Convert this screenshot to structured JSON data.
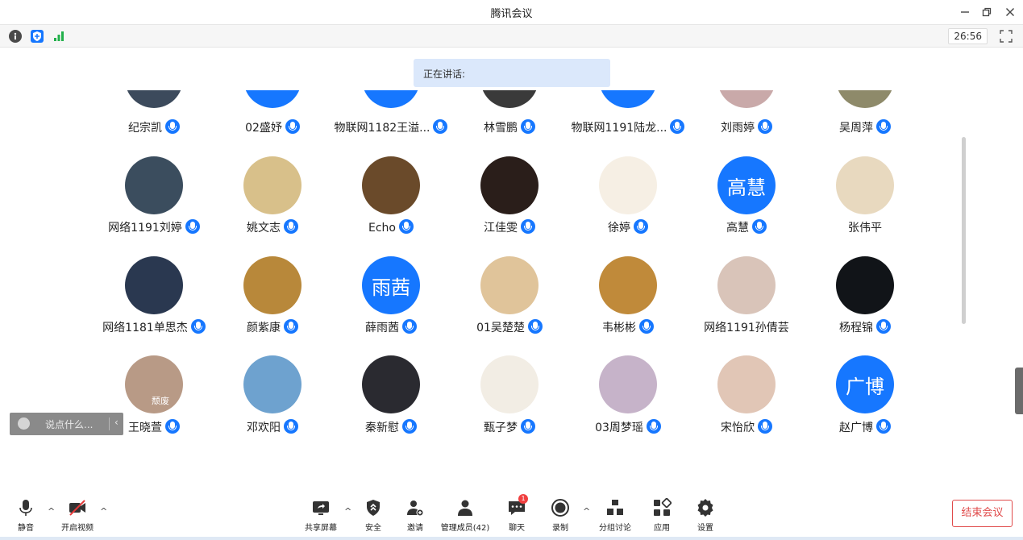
{
  "window": {
    "title": "腾讯会议",
    "timer": "26:56"
  },
  "speaking": "正在讲话:",
  "participants": [
    {
      "name": "纪宗凯",
      "avatar_color": "#3c4a5c",
      "avatar_text": ""
    },
    {
      "name": "02盛妤",
      "avatar_color": "#1677ff",
      "avatar_text": ""
    },
    {
      "name": "物联网1182王溢...",
      "avatar_color": "#1677ff",
      "avatar_text": ""
    },
    {
      "name": "林雪鹏",
      "avatar_color": "#3a3a3a",
      "avatar_text": ""
    },
    {
      "name": "物联网1191陆龙...",
      "avatar_color": "#1677ff",
      "avatar_text": ""
    },
    {
      "name": "刘雨婷",
      "avatar_color": "#c9a9a9",
      "avatar_text": ""
    },
    {
      "name": "吴周萍",
      "avatar_color": "#8e8a6a",
      "avatar_text": ""
    },
    {
      "name": "网络1191刘婷",
      "avatar_color": "#3b4d5e",
      "avatar_text": ""
    },
    {
      "name": "姚文志",
      "avatar_color": "#d8c08a",
      "avatar_text": ""
    },
    {
      "name": "Echo",
      "avatar_color": "#6a4a2a",
      "avatar_text": ""
    },
    {
      "name": "江佳雯",
      "avatar_color": "#2a1e1a",
      "avatar_text": ""
    },
    {
      "name": "徐婷",
      "avatar_color": "#f6efe4",
      "avatar_text": ""
    },
    {
      "name": "高慧",
      "avatar_color": "#1677ff",
      "avatar_text": "高慧"
    },
    {
      "name": "张伟平",
      "avatar_color": "#e8d9bf",
      "avatar_text": ""
    },
    {
      "name": "网络1181单思杰",
      "avatar_color": "#2a3850",
      "avatar_text": ""
    },
    {
      "name": "颜紫康",
      "avatar_color": "#b8883a",
      "avatar_text": ""
    },
    {
      "name": "薛雨茜",
      "avatar_color": "#1677ff",
      "avatar_text": "雨茜"
    },
    {
      "name": "01吴楚楚",
      "avatar_color": "#e0c49a",
      "avatar_text": ""
    },
    {
      "name": "韦彬彬",
      "avatar_color": "#c08a3a",
      "avatar_text": ""
    },
    {
      "name": "网络1191孙倩芸",
      "avatar_color": "#d9c4b9",
      "avatar_text": ""
    },
    {
      "name": "杨程锦",
      "avatar_color": "#111418",
      "avatar_text": ""
    },
    {
      "name": "王晓萱",
      "avatar_color": "#b89a86",
      "avatar_text": "颓废"
    },
    {
      "name": "邓欢阳",
      "avatar_color": "#6ea2cf",
      "avatar_text": ""
    },
    {
      "name": "秦新慰",
      "avatar_color": "#2a2a30",
      "avatar_text": ""
    },
    {
      "name": "甄子梦",
      "avatar_color": "#f2ede4",
      "avatar_text": ""
    },
    {
      "name": "03周梦瑶",
      "avatar_color": "#c6b3c9",
      "avatar_text": ""
    },
    {
      "name": "宋怡欣",
      "avatar_color": "#e1c6b6",
      "avatar_text": ""
    },
    {
      "name": "赵广博",
      "avatar_color": "#1677ff",
      "avatar_text": "广博"
    }
  ],
  "mic_flags": [
    true,
    true,
    true,
    true,
    true,
    true,
    true,
    true,
    true,
    true,
    true,
    true,
    true,
    false,
    true,
    true,
    true,
    true,
    true,
    false,
    true,
    true,
    true,
    true,
    true,
    true,
    true,
    true
  ],
  "chat": {
    "placeholder": "说点什么..."
  },
  "toolbar": {
    "mute": "静音",
    "video": "开启视频",
    "share": "共享屏幕",
    "security": "安全",
    "invite": "邀请",
    "members": "管理成员(42)",
    "chat": "聊天",
    "chat_badge": "1",
    "record": "录制",
    "breakout": "分组讨论",
    "apps": "应用",
    "settings": "设置",
    "end": "结束会议"
  },
  "colors": {
    "accent": "#1677ff",
    "end": "#e04a4a"
  }
}
